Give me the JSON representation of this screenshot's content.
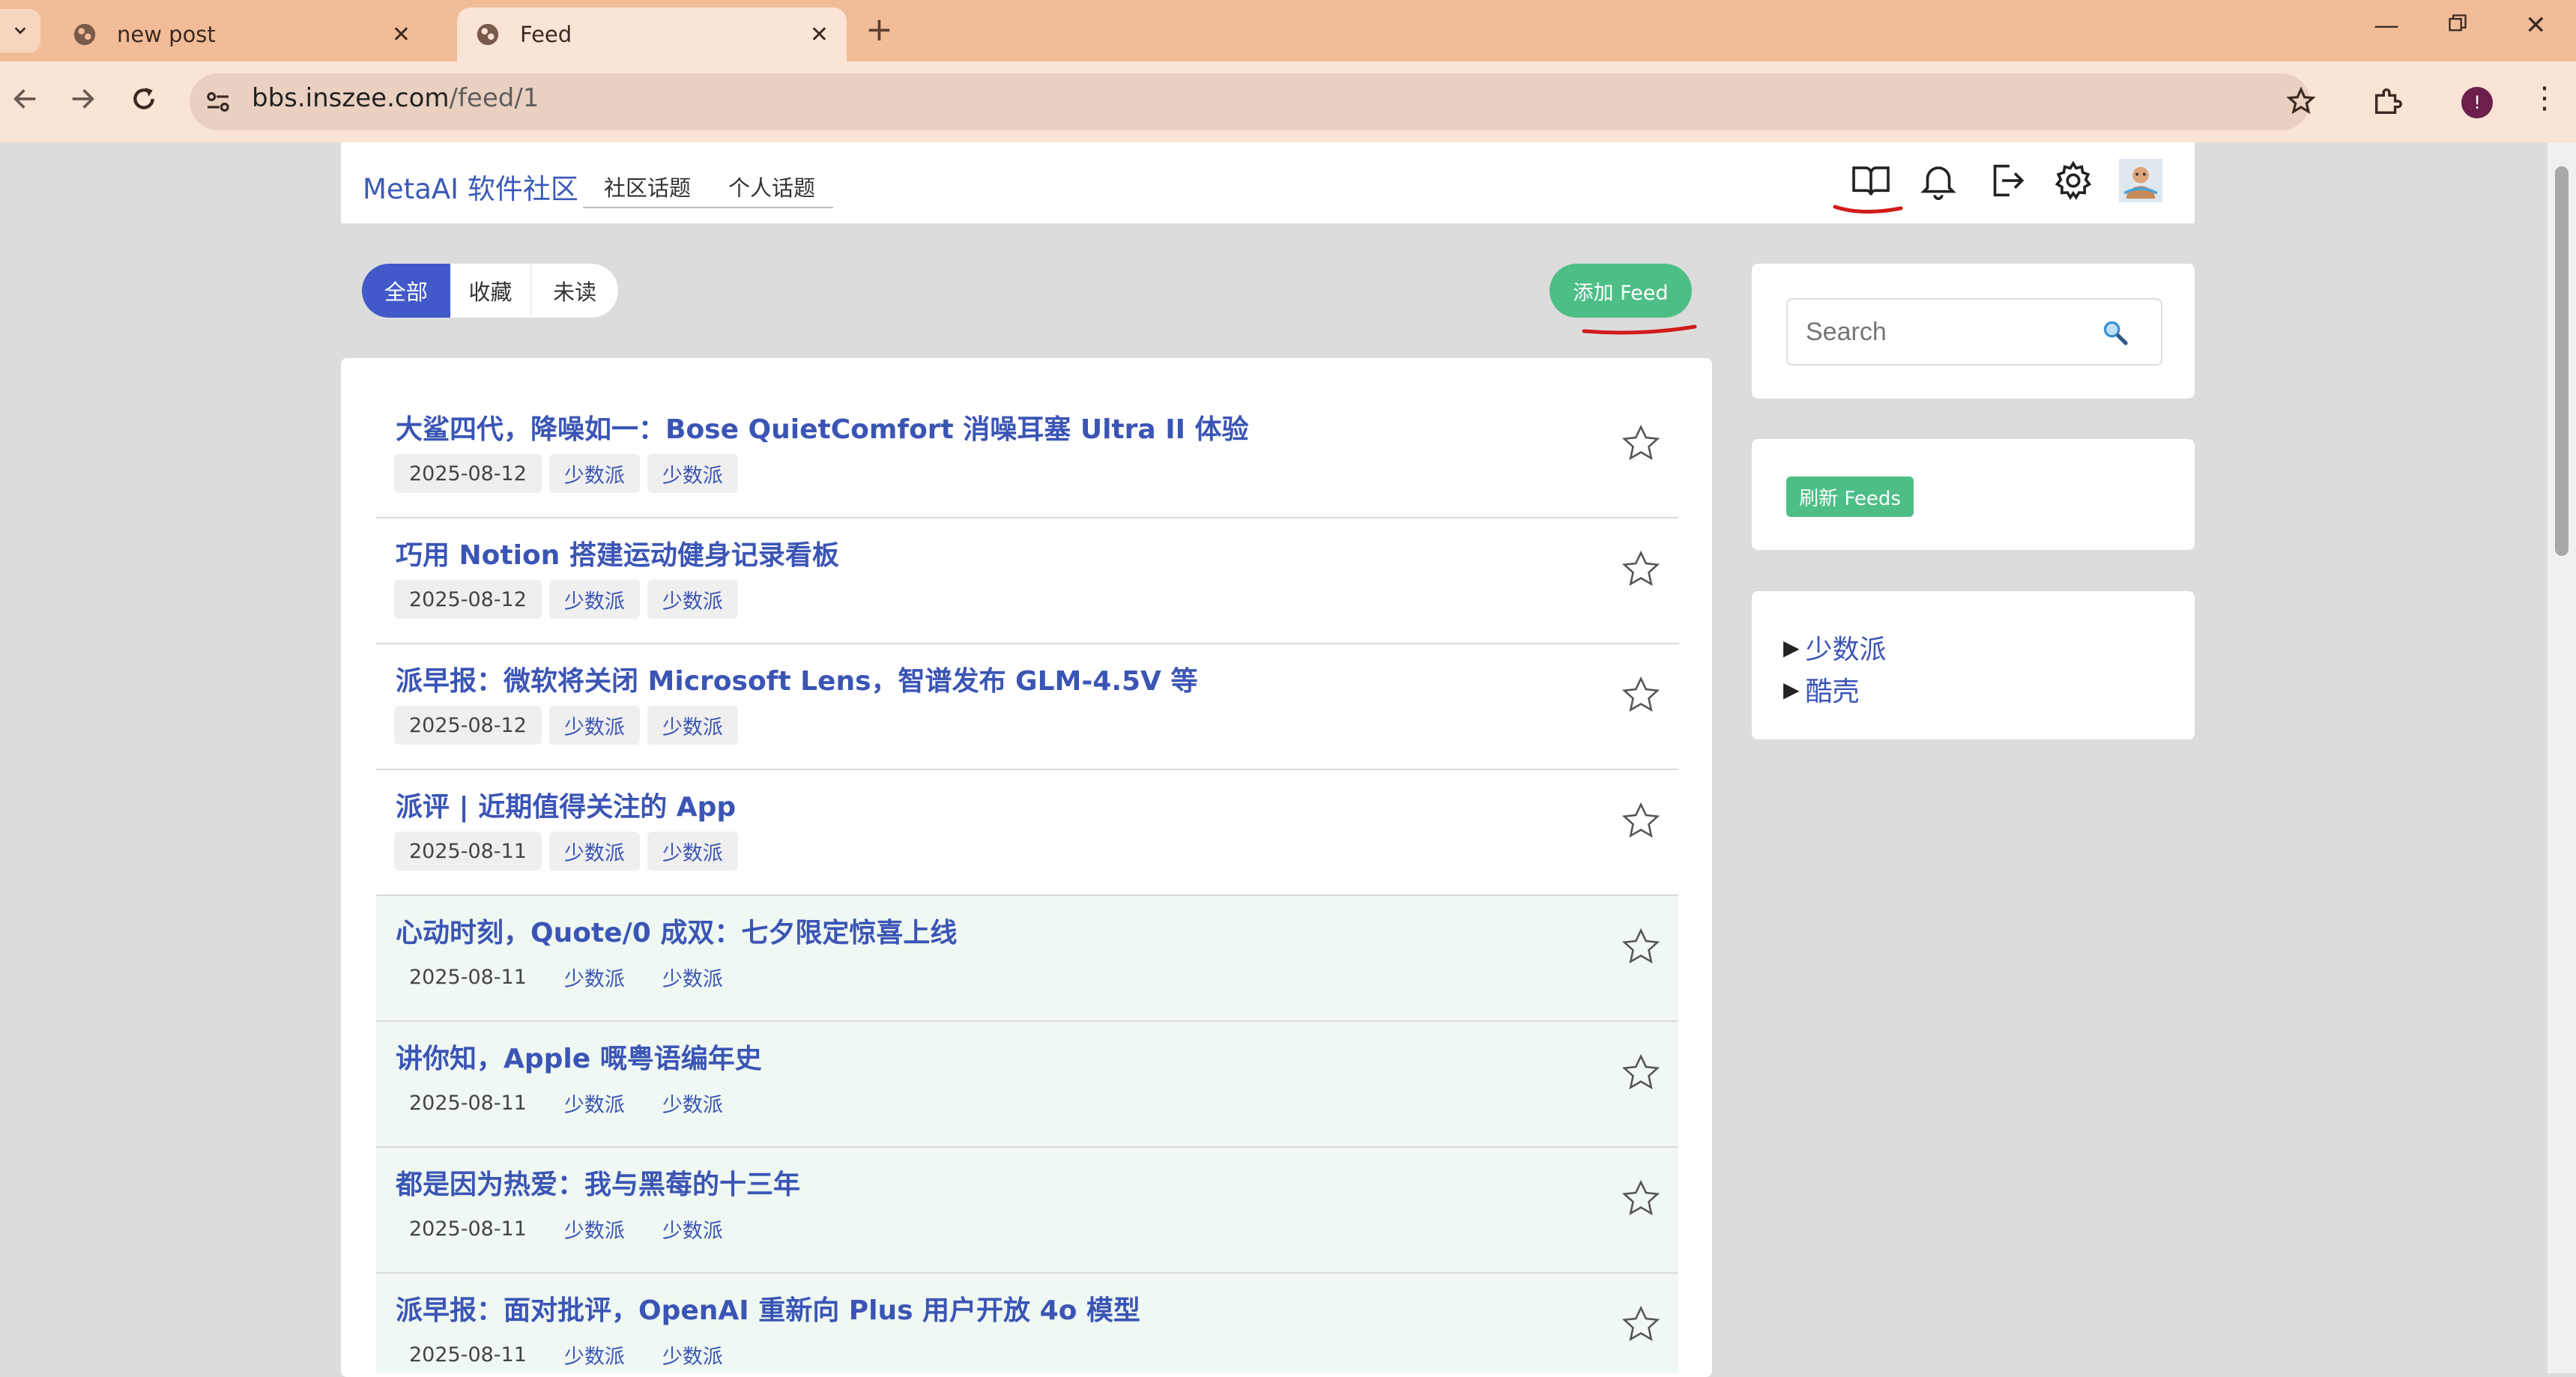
{
  "browser": {
    "tabs": [
      {
        "title": "new post",
        "active": false
      },
      {
        "title": "Feed",
        "active": true
      }
    ],
    "url_host": "bbs.inszee.com",
    "url_path": "/feed/1"
  },
  "header": {
    "brand": "MetaAI 软件社区",
    "nav": [
      "社区话题",
      "个人话题"
    ],
    "icons": [
      "book-icon",
      "bell-icon",
      "logout-icon",
      "gear-icon",
      "avatar"
    ]
  },
  "filters": {
    "items": [
      "全部",
      "收藏",
      "未读"
    ],
    "active": "全部",
    "add_feed": "添加 Feed"
  },
  "feeds": [
    {
      "title": "大鲨四代，降噪如一：Bose QuietComfort 消噪耳塞 Ultra II 体验",
      "date": "2025-08-12",
      "tags": [
        "少数派",
        "少数派"
      ],
      "unread": false
    },
    {
      "title": "巧用 Notion 搭建运动健身记录看板",
      "date": "2025-08-12",
      "tags": [
        "少数派",
        "少数派"
      ],
      "unread": false
    },
    {
      "title": "派早报：微软将关闭 Microsoft Lens，智谱发布 GLM-4.5V 等",
      "date": "2025-08-12",
      "tags": [
        "少数派",
        "少数派"
      ],
      "unread": false
    },
    {
      "title": "派评 | 近期值得关注的 App",
      "date": "2025-08-11",
      "tags": [
        "少数派",
        "少数派"
      ],
      "unread": false
    },
    {
      "title": "心动时刻，Quote/0 成双：七夕限定惊喜上线",
      "date": "2025-08-11",
      "tags": [
        "少数派",
        "少数派"
      ],
      "unread": true
    },
    {
      "title": "讲你知，Apple 嘅粤语编年史",
      "date": "2025-08-11",
      "tags": [
        "少数派",
        "少数派"
      ],
      "unread": true
    },
    {
      "title": "都是因为热爱：我与黑莓的十三年",
      "date": "2025-08-11",
      "tags": [
        "少数派",
        "少数派"
      ],
      "unread": true
    },
    {
      "title": "派早报：面对批评，OpenAI 重新向 Plus 用户开放 4o 模型",
      "date": "2025-08-11",
      "tags": [
        "少数派",
        "少数派"
      ],
      "unread": true
    }
  ],
  "sidebar": {
    "search_placeholder": "Search",
    "refresh_label": "刷新 Feeds",
    "categories": [
      "少数派",
      "酷壳"
    ]
  },
  "colors": {
    "accent": "#4159c9",
    "green": "#4dbf86",
    "link": "#3b55b5",
    "unread_bg": "#eff8f2",
    "tab_strip": "#f1bc97"
  }
}
